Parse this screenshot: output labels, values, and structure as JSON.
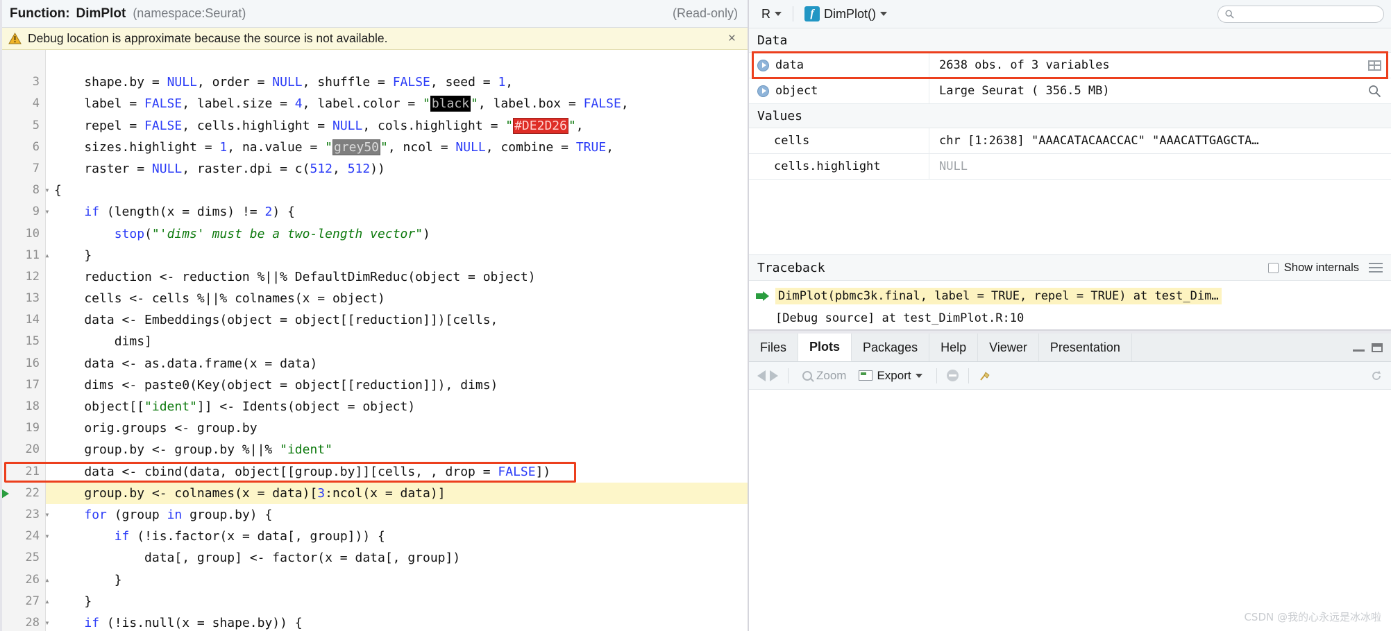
{
  "source_pane": {
    "title_label": "Function:",
    "function_name": "DimPlot",
    "namespace": "(namespace:Seurat)",
    "readonly": "(Read-only)",
    "warning": {
      "icon": "warning-triangle-icon",
      "text": "Debug location is approximate because the source is not available.",
      "close": "×"
    },
    "code_lines": [
      {
        "num": "",
        "fold": "",
        "debug": false,
        "tokens": []
      },
      {
        "num": "3",
        "fold": "",
        "debug": false,
        "tokens": [
          {
            "t": "    shape.by = ",
            "c": "plain"
          },
          {
            "t": "NULL",
            "c": "kw"
          },
          {
            "t": ", order = ",
            "c": "plain"
          },
          {
            "t": "NULL",
            "c": "kw"
          },
          {
            "t": ", shuffle = ",
            "c": "plain"
          },
          {
            "t": "FALSE",
            "c": "kw"
          },
          {
            "t": ", seed = ",
            "c": "plain"
          },
          {
            "t": "1",
            "c": "num"
          },
          {
            "t": ",",
            "c": "plain"
          }
        ]
      },
      {
        "num": "4",
        "fold": "",
        "debug": false,
        "tokens": [
          {
            "t": "    label = ",
            "c": "plain"
          },
          {
            "t": "FALSE",
            "c": "kw"
          },
          {
            "t": ", label.size = ",
            "c": "plain"
          },
          {
            "t": "4",
            "c": "num"
          },
          {
            "t": ", label.color = ",
            "c": "plain"
          },
          {
            "t": "\"",
            "c": "str"
          },
          {
            "t": "black",
            "c": "swatch-black"
          },
          {
            "t": "\"",
            "c": "str"
          },
          {
            "t": ", label.box = ",
            "c": "plain"
          },
          {
            "t": "FALSE",
            "c": "kw"
          },
          {
            "t": ",",
            "c": "plain"
          }
        ]
      },
      {
        "num": "5",
        "fold": "",
        "debug": false,
        "tokens": [
          {
            "t": "    repel = ",
            "c": "plain"
          },
          {
            "t": "FALSE",
            "c": "kw"
          },
          {
            "t": ", cells.highlight = ",
            "c": "plain"
          },
          {
            "t": "NULL",
            "c": "kw"
          },
          {
            "t": ", cols.highlight = ",
            "c": "plain"
          },
          {
            "t": "\"",
            "c": "str"
          },
          {
            "t": "#DE2D26",
            "c": "swatch-red"
          },
          {
            "t": "\"",
            "c": "str"
          },
          {
            "t": ",",
            "c": "plain"
          }
        ]
      },
      {
        "num": "6",
        "fold": "",
        "debug": false,
        "tokens": [
          {
            "t": "    sizes.highlight = ",
            "c": "plain"
          },
          {
            "t": "1",
            "c": "num"
          },
          {
            "t": ", na.value = ",
            "c": "plain"
          },
          {
            "t": "\"",
            "c": "str"
          },
          {
            "t": "grey50",
            "c": "swatch-grey50"
          },
          {
            "t": "\"",
            "c": "str"
          },
          {
            "t": ", ncol = ",
            "c": "plain"
          },
          {
            "t": "NULL",
            "c": "kw"
          },
          {
            "t": ", combine = ",
            "c": "plain"
          },
          {
            "t": "TRUE",
            "c": "kw"
          },
          {
            "t": ",",
            "c": "plain"
          }
        ]
      },
      {
        "num": "7",
        "fold": "",
        "debug": false,
        "tokens": [
          {
            "t": "    raster = ",
            "c": "plain"
          },
          {
            "t": "NULL",
            "c": "kw"
          },
          {
            "t": ", raster.dpi = c(",
            "c": "plain"
          },
          {
            "t": "512",
            "c": "num"
          },
          {
            "t": ", ",
            "c": "plain"
          },
          {
            "t": "512",
            "c": "num"
          },
          {
            "t": "))",
            "c": "plain"
          }
        ]
      },
      {
        "num": "8",
        "fold": "▾",
        "debug": false,
        "tokens": [
          {
            "t": "{",
            "c": "plain"
          }
        ]
      },
      {
        "num": "9",
        "fold": "▾",
        "debug": false,
        "tokens": [
          {
            "t": "    ",
            "c": "plain"
          },
          {
            "t": "if",
            "c": "ctl"
          },
          {
            "t": " (length(x = dims) != ",
            "c": "plain"
          },
          {
            "t": "2",
            "c": "num"
          },
          {
            "t": ") {",
            "c": "plain"
          }
        ]
      },
      {
        "num": "10",
        "fold": "",
        "debug": false,
        "tokens": [
          {
            "t": "        ",
            "c": "plain"
          },
          {
            "t": "stop",
            "c": "ctl"
          },
          {
            "t": "(",
            "c": "plain"
          },
          {
            "t": "\"'dims' must be a two-length vector\"",
            "c": "italicstr"
          },
          {
            "t": ")",
            "c": "plain"
          }
        ]
      },
      {
        "num": "11",
        "fold": "▴",
        "debug": false,
        "tokens": [
          {
            "t": "    }",
            "c": "plain"
          }
        ]
      },
      {
        "num": "12",
        "fold": "",
        "debug": false,
        "tokens": [
          {
            "t": "    reduction <- reduction %||% DefaultDimReduc(object = object)",
            "c": "plain"
          }
        ]
      },
      {
        "num": "13",
        "fold": "",
        "debug": false,
        "tokens": [
          {
            "t": "    cells <- cells %||% colnames(x = object)",
            "c": "plain"
          }
        ]
      },
      {
        "num": "14",
        "fold": "",
        "debug": false,
        "tokens": [
          {
            "t": "    data <- Embeddings(object = object[[reduction]])[cells,",
            "c": "plain"
          }
        ]
      },
      {
        "num": "15",
        "fold": "",
        "debug": false,
        "tokens": [
          {
            "t": "        dims]",
            "c": "plain"
          }
        ]
      },
      {
        "num": "16",
        "fold": "",
        "debug": false,
        "tokens": [
          {
            "t": "    data <- as.data.frame(x = data)",
            "c": "plain"
          }
        ]
      },
      {
        "num": "17",
        "fold": "",
        "debug": false,
        "tokens": [
          {
            "t": "    dims <- paste0(Key(object = object[[reduction]]), dims)",
            "c": "plain"
          }
        ]
      },
      {
        "num": "18",
        "fold": "",
        "debug": false,
        "tokens": [
          {
            "t": "    object[[",
            "c": "plain"
          },
          {
            "t": "\"ident\"",
            "c": "str"
          },
          {
            "t": "]] <- Idents(object = object)",
            "c": "plain"
          }
        ]
      },
      {
        "num": "19",
        "fold": "",
        "debug": false,
        "tokens": [
          {
            "t": "    orig.groups <- group.by",
            "c": "plain"
          }
        ]
      },
      {
        "num": "20",
        "fold": "",
        "debug": false,
        "tokens": [
          {
            "t": "    group.by <- group.by %||% ",
            "c": "plain"
          },
          {
            "t": "\"ident\"",
            "c": "str"
          }
        ]
      },
      {
        "num": "21",
        "fold": "",
        "debug": false,
        "annotated": true,
        "tokens": [
          {
            "t": "    data <- cbind(data, object[[group.by]][cells, , drop = ",
            "c": "plain"
          },
          {
            "t": "FALSE",
            "c": "kw"
          },
          {
            "t": "])",
            "c": "plain"
          }
        ]
      },
      {
        "num": "22",
        "fold": "",
        "debug": true,
        "tokens": [
          {
            "t": "    group.by <- colnames(x = data)[",
            "c": "plain"
          },
          {
            "t": "3",
            "c": "num"
          },
          {
            "t": ":ncol(x = data)]",
            "c": "plain"
          }
        ]
      },
      {
        "num": "23",
        "fold": "▾",
        "debug": false,
        "tokens": [
          {
            "t": "    ",
            "c": "plain"
          },
          {
            "t": "for",
            "c": "ctl"
          },
          {
            "t": " (group ",
            "c": "plain"
          },
          {
            "t": "in",
            "c": "ctl"
          },
          {
            "t": " group.by) {",
            "c": "plain"
          }
        ]
      },
      {
        "num": "24",
        "fold": "▾",
        "debug": false,
        "tokens": [
          {
            "t": "        ",
            "c": "plain"
          },
          {
            "t": "if",
            "c": "ctl"
          },
          {
            "t": " (!is.factor(x = data[, group])) {",
            "c": "plain"
          }
        ]
      },
      {
        "num": "25",
        "fold": "",
        "debug": false,
        "tokens": [
          {
            "t": "            data[, group] <- factor(x = data[, group])",
            "c": "plain"
          }
        ]
      },
      {
        "num": "26",
        "fold": "▴",
        "debug": false,
        "tokens": [
          {
            "t": "        }",
            "c": "plain"
          }
        ]
      },
      {
        "num": "27",
        "fold": "▴",
        "debug": false,
        "tokens": [
          {
            "t": "    }",
            "c": "plain"
          }
        ]
      },
      {
        "num": "28",
        "fold": "▾",
        "debug": false,
        "tokens": [
          {
            "t": "    ",
            "c": "plain"
          },
          {
            "t": "if",
            "c": "ctl"
          },
          {
            "t": " (!is.null(x = shape.by)) {",
            "c": "plain"
          }
        ]
      }
    ]
  },
  "environment_pane": {
    "toolbar": {
      "language": "R",
      "fn_badge": "f",
      "scope": "DimPlot()",
      "search_placeholder": ""
    },
    "sections": [
      {
        "title": "Data",
        "rows": [
          {
            "name": "data",
            "value": "2638 obs. of 3 variables",
            "expandable": true,
            "indent": false,
            "viewer": true,
            "annotated": true
          },
          {
            "name": "object",
            "value": "Large Seurat ( 356.5 MB)",
            "expandable": true,
            "indent": false,
            "search_icon": true,
            "annotated": false
          }
        ]
      },
      {
        "title": "Values",
        "rows": [
          {
            "name": "cells",
            "value": "chr [1:2638] \"AAACATACAACCAC\" \"AAACATTGAGCTA…",
            "expandable": false,
            "indent": true,
            "annotated": false
          },
          {
            "name": "cells.highlight",
            "value": "NULL",
            "expandable": false,
            "indent": true,
            "null": true,
            "annotated": false
          }
        ]
      }
    ],
    "traceback": {
      "title": "Traceback",
      "show_internals_label": "Show internals",
      "show_internals_checked": false,
      "entries": [
        {
          "text": "DimPlot(pbmc3k.final, label = TRUE, repel = TRUE) at test_Dim…",
          "active": true,
          "arrow": true
        },
        {
          "text": "[Debug source] at test_DimPlot.R:10",
          "active": false,
          "arrow": false
        }
      ]
    }
  },
  "plots_pane": {
    "tabs": [
      {
        "label": "Files",
        "active": false
      },
      {
        "label": "Plots",
        "active": true
      },
      {
        "label": "Packages",
        "active": false
      },
      {
        "label": "Help",
        "active": false
      },
      {
        "label": "Viewer",
        "active": false
      },
      {
        "label": "Presentation",
        "active": false
      }
    ],
    "toolbar": {
      "back": "back-arrow-icon",
      "forward": "forward-arrow-icon",
      "zoom_label": "Zoom",
      "export_label": "Export",
      "clear": "clear-plot-icon",
      "broom": "broom-icon",
      "refresh": "refresh-icon"
    },
    "watermark": "CSDN @我的心永远是冰冰啦"
  },
  "colors": {
    "annotation_red": "#ec3f1d",
    "swatch_red": "#DE2D26",
    "debug_highlight": "#fdf6c9",
    "warn_bg": "#fbf8dd",
    "accent_blue": "#2196c4"
  }
}
